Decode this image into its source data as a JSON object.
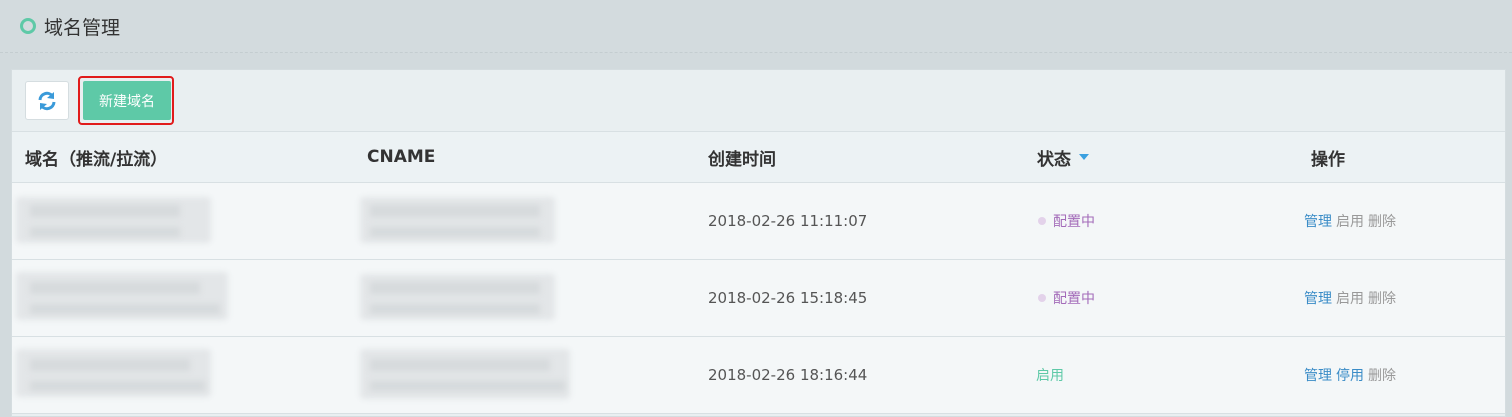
{
  "header": {
    "title": "域名管理"
  },
  "toolbar": {
    "new_domain_label": "新建域名"
  },
  "table": {
    "columns": {
      "domain": "域名（推流/拉流）",
      "cname": "CNAME",
      "created": "创建时间",
      "status": "状态",
      "actions": "操作"
    },
    "rows": [
      {
        "created": "2018-02-26 11:11:07",
        "status": "配置中",
        "actions": [
          "管理",
          "启用",
          "删除"
        ]
      },
      {
        "created": "2018-02-26 15:18:45",
        "status": "配置中",
        "actions": [
          "管理",
          "启用",
          "删除"
        ]
      },
      {
        "created": "2018-02-26 18:16:44",
        "status": "启用",
        "actions": [
          "管理",
          "停用",
          "删除"
        ]
      }
    ]
  },
  "colors": {
    "accent": "#5ec9a7",
    "link": "#3a8cc7",
    "status_config": "#a36bb9",
    "highlight": "#e11b1b"
  },
  "icons": {
    "refresh": "refresh-icon",
    "header_marker": "circle-icon",
    "sort": "caret-down-icon"
  }
}
